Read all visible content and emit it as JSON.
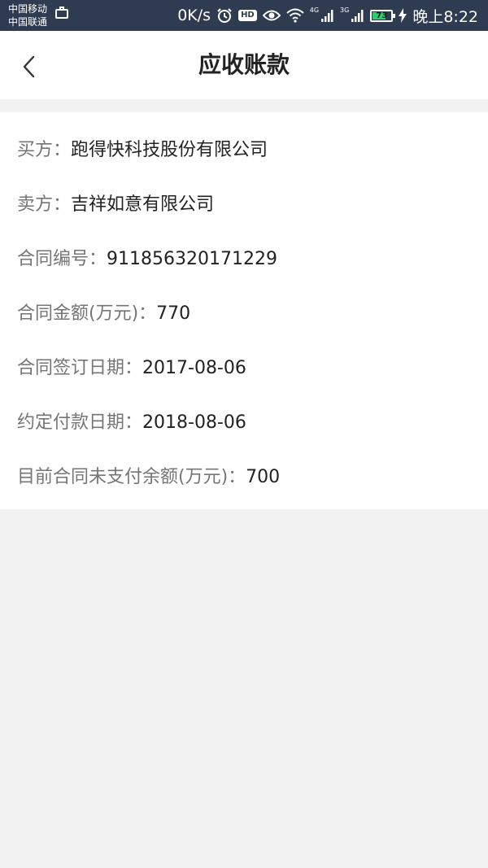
{
  "status_bar": {
    "carrier_1": "中国移动",
    "carrier_2": "中国联通",
    "speed": "0K/s",
    "hd": "HD",
    "net_4g": "4G",
    "net_3g": "3G",
    "battery_level": "73",
    "time": "晚上8:22",
    "battery_color": "#2ecc71"
  },
  "header": {
    "title": "应收账款"
  },
  "details": [
    {
      "label": "买方：",
      "value": "跑得快科技股份有限公司"
    },
    {
      "label": "卖方：",
      "value": "吉祥如意有限公司"
    },
    {
      "label": "合同编号：",
      "value": "911856320171229"
    },
    {
      "label": "合同金额(万元)：",
      "value": "770"
    },
    {
      "label": "合同签订日期：",
      "value": "2017-08-06"
    },
    {
      "label": "约定付款日期：",
      "value": "2018-08-06"
    },
    {
      "label": "目前合同未支付余额(万元)：",
      "value": "700"
    }
  ]
}
